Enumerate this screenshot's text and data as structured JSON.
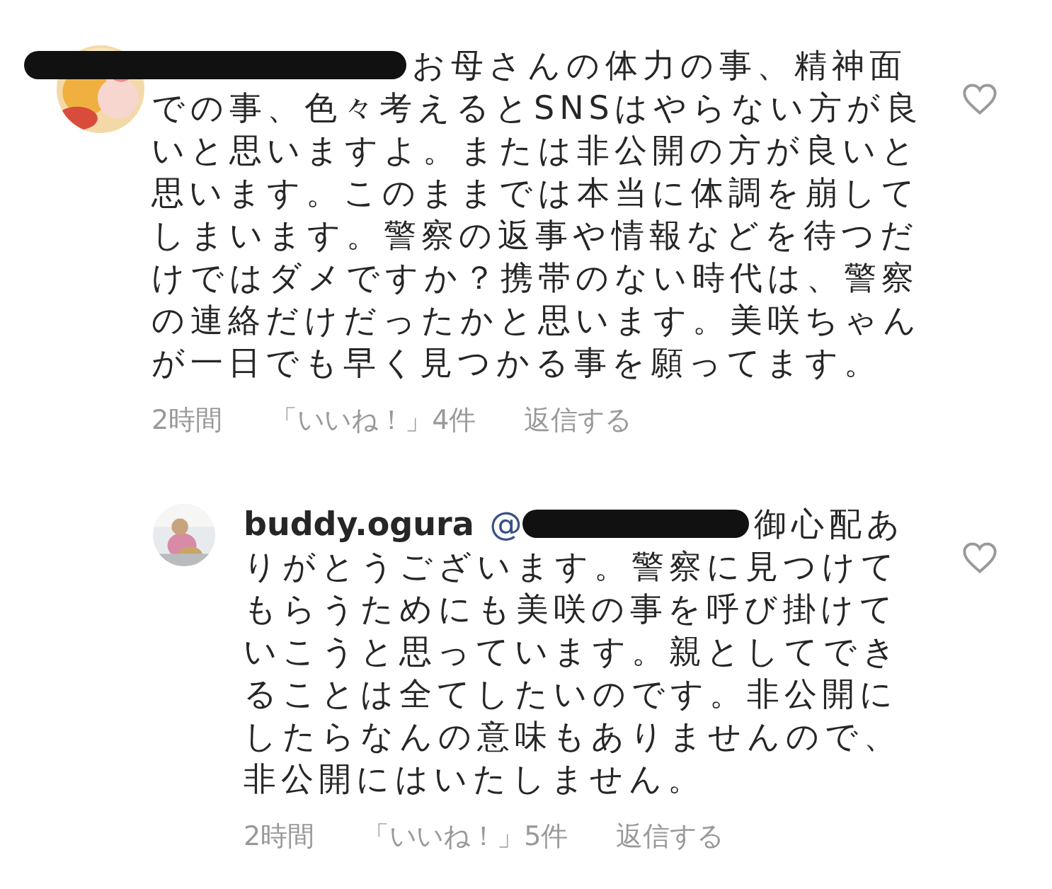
{
  "comments": [
    {
      "username_redacted": true,
      "text": "お母さんの体力の事、精神面での事、色々考えるとSNSはやらない方が良いと思いますよ。または非公開の方が良いと思います。このままでは本当に体調を崩してしまいます。警察の返事や情報などを待つだけではダメですか？携帯のない時代は、警察の連絡だけだったかと思います。美咲ちゃんが一日でも早く見つかる事を願ってます。",
      "time": "2時間",
      "likes": "「いいね！」4件",
      "reply": "返信する",
      "liked": false
    },
    {
      "username": "buddy.ogura",
      "mention": {
        "text": "@",
        "redacted": true
      },
      "text": "御心配ありがとうございます。警察に見つけてもらうためにも美咲の事を呼び掛けていこうと思っています。親としてできることは全てしたいのです。非公開にしたらなんの意味もありませんので、非公開にはいたしません。",
      "time": "2時間",
      "likes": "「いいね！」5件",
      "reply": "返信する",
      "liked": false,
      "nested": true
    }
  ]
}
